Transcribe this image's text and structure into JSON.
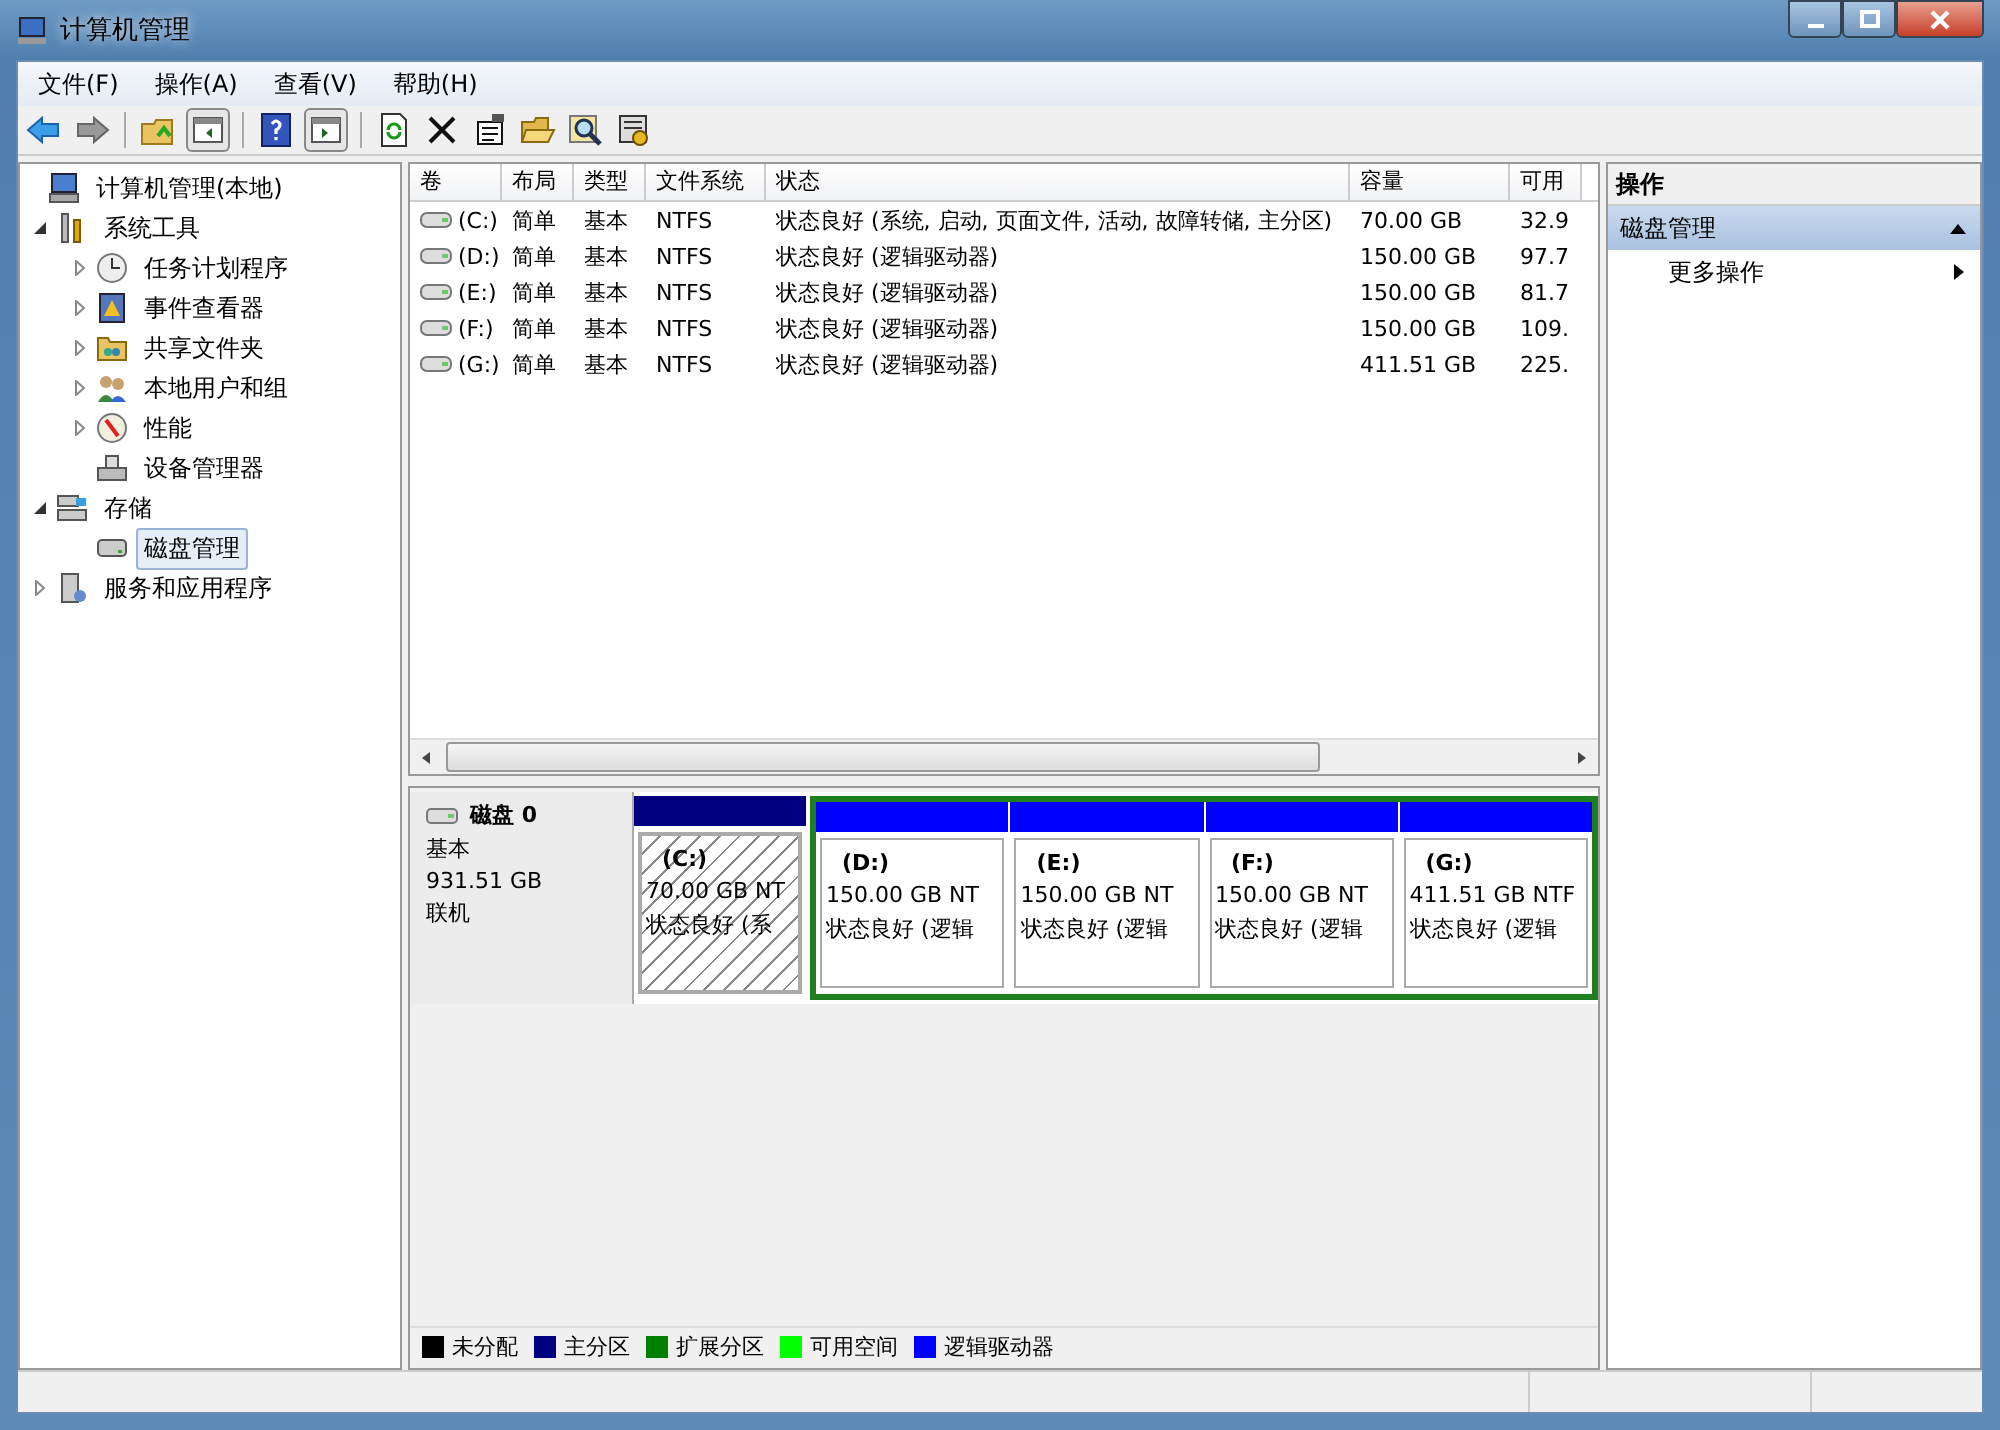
{
  "window": {
    "title": "计算机管理"
  },
  "menu": [
    "文件(F)",
    "操作(A)",
    "查看(V)",
    "帮助(H)"
  ],
  "tree": {
    "label": "计算机管理(本地)",
    "selected": false,
    "children": [
      {
        "label": "系统工具",
        "expanded": true,
        "selected": false,
        "children": [
          {
            "label": "任务计划程序",
            "expanded": false,
            "selected": false
          },
          {
            "label": "事件查看器",
            "expanded": false,
            "selected": false
          },
          {
            "label": "共享文件夹",
            "expanded": false,
            "selected": false
          },
          {
            "label": "本地用户和组",
            "expanded": false,
            "selected": false
          },
          {
            "label": "性能",
            "expanded": false,
            "selected": false
          },
          {
            "label": "设备管理器",
            "selected": false
          }
        ]
      },
      {
        "label": "存储",
        "expanded": true,
        "selected": false,
        "children": [
          {
            "label": "磁盘管理",
            "selected": true
          }
        ]
      },
      {
        "label": "服务和应用程序",
        "expanded": false,
        "selected": false
      }
    ]
  },
  "table": {
    "columns": [
      "卷",
      "布局",
      "类型",
      "文件系统",
      "状态",
      "容量",
      "可用"
    ],
    "rows": [
      [
        "(C:)",
        "简单",
        "基本",
        "NTFS",
        "状态良好 (系统, 启动, 页面文件, 活动, 故障转储, 主分区)",
        "70.00 GB",
        "32.9"
      ],
      [
        "(D:)",
        "简单",
        "基本",
        "NTFS",
        "状态良好 (逻辑驱动器)",
        "150.00 GB",
        "97.7"
      ],
      [
        "(E:)",
        "简单",
        "基本",
        "NTFS",
        "状态良好 (逻辑驱动器)",
        "150.00 GB",
        "81.7"
      ],
      [
        "(F:)",
        "简单",
        "基本",
        "NTFS",
        "状态良好 (逻辑驱动器)",
        "150.00 GB",
        "109."
      ],
      [
        "(G:)",
        "简单",
        "基本",
        "NTFS",
        "状态良好 (逻辑驱动器)",
        "411.51 GB",
        "225."
      ]
    ]
  },
  "disk": {
    "name": "磁盘 0",
    "type": "基本",
    "size": "931.51 GB",
    "status": "联机",
    "partitions": [
      {
        "kind": "primary",
        "selected": true,
        "label": "(C:)",
        "size": "70.00 GB NT",
        "status": "状态良好 (系"
      },
      {
        "kind": "logical",
        "selected": false,
        "label": "(D:)",
        "size": "150.00 GB NT",
        "status": "状态良好 (逻辑"
      },
      {
        "kind": "logical",
        "selected": false,
        "label": "(E:)",
        "size": "150.00 GB NT",
        "status": "状态良好 (逻辑"
      },
      {
        "kind": "logical",
        "selected": false,
        "label": "(F:)",
        "size": "150.00 GB NT",
        "status": "状态良好 (逻辑"
      },
      {
        "kind": "logical",
        "selected": false,
        "label": "(G:)",
        "size": "411.51 GB NTF",
        "status": "状态良好 (逻辑"
      }
    ]
  },
  "legend": [
    {
      "label": "未分配",
      "color": "#000000"
    },
    {
      "label": "主分区",
      "color": "#000080"
    },
    {
      "label": "扩展分区",
      "color": "#008000"
    },
    {
      "label": "可用空间",
      "color": "#00ff00"
    },
    {
      "label": "逻辑驱动器",
      "color": "#0000ff"
    }
  ],
  "actions": {
    "title": "操作",
    "section": {
      "label": "磁盘管理",
      "expanded": true
    },
    "items": [
      "更多操作"
    ]
  }
}
